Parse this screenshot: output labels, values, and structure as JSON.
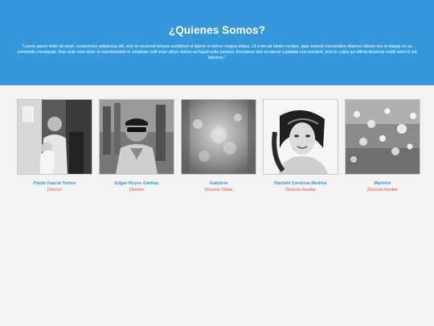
{
  "hero": {
    "title": "¿Quienes Somos?",
    "text": "\"Lorem ipsum dolor sit amet, consectetur adipiscing elit, sed do eiusmod tempor incididunt ut labore et dolore magna aliqua. Ut enim ad minim veniam, quis nostrud exercitation ullamco laboris nisi ut aliquip ex ea commodo consequat. Duis aute irure dolor in reprehenderit in voluptate velit esse cillum dolore eu fugiat nulla pariatur. Excepteur sint occaecat cupidatat non proident, sunt in culpa qui officia deserunt mollit anim id est laborum.\""
  },
  "team": [
    {
      "name": "Paola García Torres",
      "role": "Director"
    },
    {
      "name": "Edgar Reyes Garfias",
      "role": "Director"
    },
    {
      "name": "Gabriela",
      "role": "Docente Titular"
    },
    {
      "name": "Daniela Cardona Medina",
      "role": "Docente Auxiliar"
    },
    {
      "name": "Mariene",
      "role": "Docente Auxiliar"
    }
  ],
  "colors": {
    "hero_background": "#3498db",
    "name_color": "#3498db",
    "role_color": "#e74c3c",
    "page_background": "#f3f3f3"
  }
}
